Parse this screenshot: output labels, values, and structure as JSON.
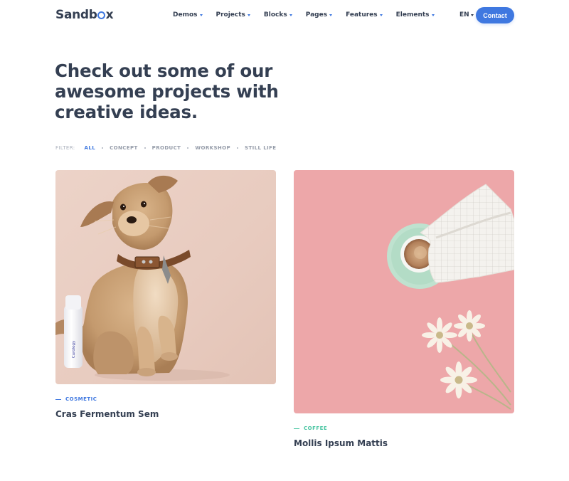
{
  "header": {
    "logo": "Sandbox",
    "nav": [
      {
        "label": "Demos"
      },
      {
        "label": "Projects"
      },
      {
        "label": "Blocks"
      },
      {
        "label": "Pages"
      },
      {
        "label": "Features"
      },
      {
        "label": "Elements"
      }
    ],
    "language": "EN",
    "contact_label": "Contact"
  },
  "hero": {
    "title": "Check out some of our awesome projects with creative ideas."
  },
  "filter": {
    "label": "FILTER:",
    "items": [
      "ALL",
      "CONCEPT",
      "PRODUCT",
      "WORKSHOP",
      "STILL LIFE"
    ],
    "active": "ALL"
  },
  "projects": [
    {
      "category": "COSMETIC",
      "title": "Cras Fermentum Sem",
      "image": "dog-with-collar-and-cosmetic-bottle",
      "bottle_text": "Curology"
    },
    {
      "category": "COFFEE",
      "title": "Mollis Ipsum Mattis",
      "image": "coffee-cup-napkin-and-daisies"
    }
  ],
  "colors": {
    "accent": "#3f78e0",
    "coffee_category": "#45c4a0",
    "text": "#343f52"
  }
}
